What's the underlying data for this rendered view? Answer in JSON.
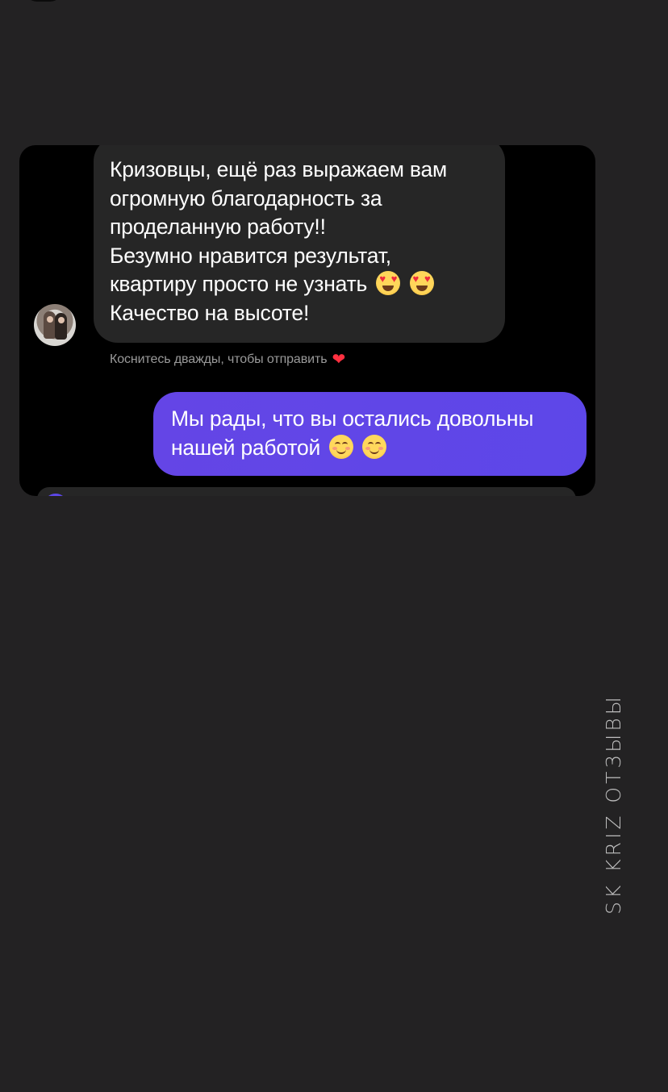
{
  "conversation": {
    "incoming_message": {
      "lines": [
        "Кризовцы, ещё раз выражаем вам",
        "огромную благодарность за",
        "проделанную работу!!",
        "Безумно нравится результат,",
        "квартиру просто не узнать",
        "Качество на высоте!"
      ],
      "emoji": [
        "heart-eyes-emoji",
        "heart-eyes-emoji"
      ]
    },
    "double_tap_hint": "Коснитесь дважды, чтобы отправить",
    "hint_icon": "red-heart-icon",
    "outgoing_message": {
      "lines": [
        "Мы рады, что вы остались довольны",
        "нашей работой"
      ],
      "emoji": [
        "smiling-face-emoji",
        "smiling-face-emoji"
      ],
      "bubble_color": "#5d47e8"
    }
  },
  "watermark": "SK KRIZ ОТЗЫВЫ",
  "colors": {
    "background": "#232223",
    "chat_background": "#000000",
    "incoming_bubble": "#262626",
    "outgoing_bubble": "#5d47e8",
    "hint_text": "#9a9a9a",
    "heart": "#ff3040"
  }
}
